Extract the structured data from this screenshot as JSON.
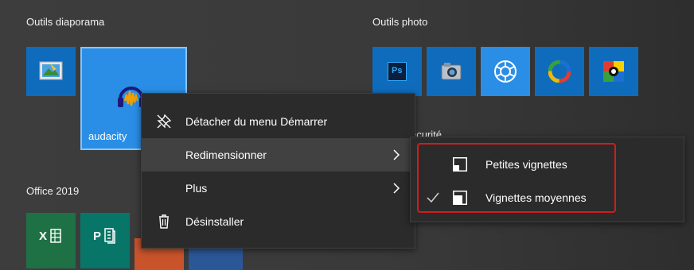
{
  "groups": {
    "diaporama": "Outils diaporama",
    "photo": "Outils photo",
    "office": "Office 2019",
    "securite_partial": "écurité"
  },
  "tiles": {
    "audacity": "audacity",
    "photoshop": "Ps",
    "excel": "X",
    "publisher": "P"
  },
  "context_menu": {
    "unpin": "Détacher du menu Démarrer",
    "resize": "Redimensionner",
    "more": "Plus",
    "uninstall": "Désinstaller"
  },
  "submenu": {
    "small": "Petites vignettes",
    "medium": "Vignettes moyennes",
    "selected": "medium"
  },
  "colors": {
    "tile_blue": "#0f6cbd",
    "tile_selected": "#2a8ee6",
    "excel_green": "#1e7145",
    "publisher_teal": "#077568",
    "highlight_red": "#d31c1c"
  }
}
